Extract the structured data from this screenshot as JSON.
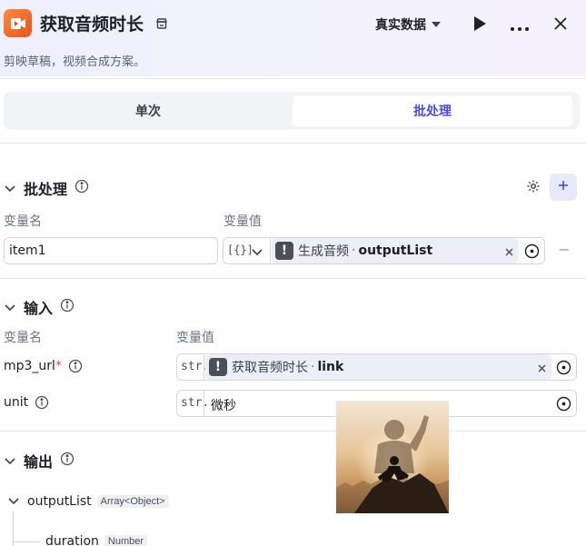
{
  "header": {
    "title": "获取音频时长",
    "data_mode": "真实数据",
    "subtitle": "剪映草稿，视频合成方案。"
  },
  "tabs": [
    {
      "label": "单次",
      "active": false
    },
    {
      "label": "批处理",
      "active": true
    }
  ],
  "batch": {
    "title": "批处理",
    "col_name": "变量名",
    "col_value": "变量值",
    "item_name": "item1",
    "type_label": "[{}]",
    "ref_node": "生成音频",
    "ref_sep": "·",
    "ref_field": "outputList",
    "remove_label": "−"
  },
  "input": {
    "title": "输入",
    "col_name": "变量名",
    "col_value": "变量值",
    "rows": [
      {
        "name": "mp3_url",
        "required_mark": "*",
        "type": "str.",
        "ref_node": "获取音频时长",
        "ref_sep": "·",
        "ref_field": "link"
      },
      {
        "name": "unit",
        "type": "str.",
        "value": "微秒"
      }
    ]
  },
  "output": {
    "title": "输出",
    "items": [
      {
        "name": "outputList",
        "type": "Array<Object>"
      },
      {
        "name": "duration",
        "type": "Number"
      }
    ]
  },
  "colors": {
    "accent": "#4c4de0",
    "warn_badge": "#4a4f59",
    "app_icon": "#e8531b"
  },
  "icons": [
    "store-icon",
    "chevron-down-icon",
    "play-icon",
    "more-icon",
    "close-icon",
    "info-icon",
    "gear-icon",
    "plus-icon",
    "clear-icon",
    "variable-picker-icon",
    "collapse-chevron-icon",
    "warning-icon"
  ]
}
